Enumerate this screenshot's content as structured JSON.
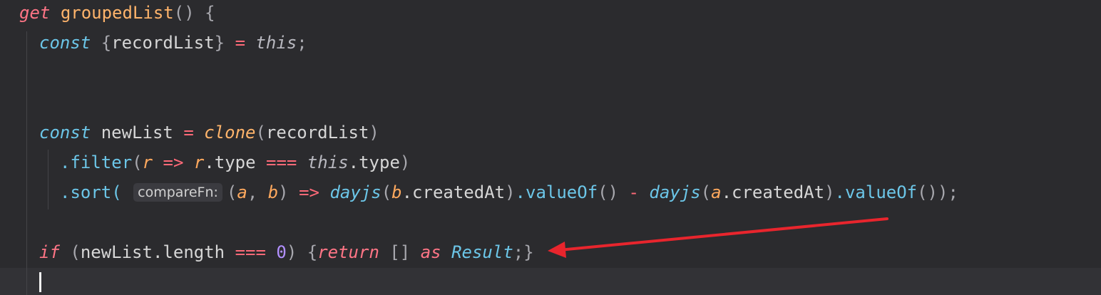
{
  "code": {
    "get_kw": "get",
    "method_name": "groupedList",
    "method_parens": "() {",
    "l2_const": "const",
    "l2_open": "{",
    "l2_var": "recordList",
    "l2_close": "}",
    "l2_eq": "=",
    "l2_this": "this",
    "l2_semi": ";",
    "l5_const": "const",
    "l5_var": "newList",
    "l5_eq": "=",
    "l5_fn": "clone",
    "l5_open": "(",
    "l5_arg": "recordList",
    "l5_close": ")",
    "l6_dot": ".filter",
    "l6_open": "(",
    "l6_param": "r",
    "l6_arrow": "=>",
    "l6_param2": "r",
    "l6_prop": ".type",
    "l6_eqq": "===",
    "l6_this": "this",
    "l6_prop2": ".type",
    "l6_close": ")",
    "l7_dot": ".sort(",
    "l7_hint": "compareFn:",
    "l7_open": "(",
    "l7_a": "a",
    "l7_comma": ",",
    "l7_b": "b",
    "l7_close": ")",
    "l7_arrow": "=>",
    "l7_dayjs1": "dayjs",
    "l7_p1o": "(",
    "l7_b2": "b",
    "l7_created1": ".createdAt",
    "l7_p1c": ")",
    "l7_value1": ".valueOf",
    "l7_call1": "()",
    "l7_minus": "-",
    "l7_dayjs2": "dayjs",
    "l7_p2o": "(",
    "l7_a2": "a",
    "l7_created2": ".createdAt",
    "l7_p2c": ")",
    "l7_value2": ".valueOf",
    "l7_end": "());",
    "l9_if": "if",
    "l9_open": "(",
    "l9_var": "newList",
    "l9_len": ".length",
    "l9_eqq": "===",
    "l9_zero": "0",
    "l9_close": ")",
    "l9_brace": "{",
    "l9_return": "return",
    "l9_arr": "[]",
    "l9_as": "as",
    "l9_type": "Result",
    "l9_end": ";}"
  },
  "colors": {
    "background": "#2b2b2e",
    "keyword": "#ff7586",
    "function": "#ffb46b",
    "type": "#6cc6e8",
    "number": "#b290ff",
    "annotation_arrow": "#e8252d"
  }
}
